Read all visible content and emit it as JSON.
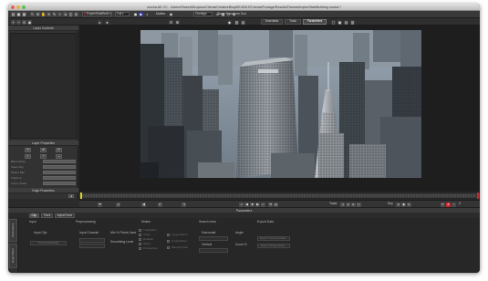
{
  "window": {
    "title": "mocha AE CC - /Users/Shared/Dropbox/Clients/CreativeBloq/EE40019/Tutorial/Footage/Results/Flames/empireStateBuilding.mocha *"
  },
  "toolbar": {
    "clip_name": "EmpireStateBuild",
    "resolution": "Full",
    "zoom_label": "Overlays",
    "show_transform": "Show Transform Tool",
    "views": [
      "Essentials",
      "Track",
      "Roto",
      "Parameters"
    ],
    "icons": [
      "new-icon",
      "open-icon",
      "save-icon",
      "pointer-icon",
      "zoom-icon",
      "hand-icon",
      "spline-x-icon",
      "bezier-x-icon",
      "add-point-icon",
      "transform-icon",
      "align-icon",
      "track-icon"
    ]
  },
  "left_panel": {
    "layer_controls_title": "Layer Controls",
    "layer_properties_title": "Layer Properties",
    "edge_properties_title": "Edge Properties",
    "fields": [
      "Blend Mode",
      "Insert Clip",
      "Motion Blur",
      "Track on",
      "Link to Track"
    ]
  },
  "transport": {
    "track_label": "Track",
    "key_label": "Key",
    "frame_value": "0"
  },
  "parameters": {
    "title": "Parameters",
    "tabs": [
      "Clip",
      "Track",
      "AdjustTrack"
    ],
    "side_tabs": [
      "Parameters",
      "Dope Sheet"
    ],
    "sections": {
      "input": "Input",
      "input_clip": "Input Clip",
      "preprocessing": "Preprocessing",
      "input_channel": "Input Channel",
      "min_pixels": "Min % Pixels Used",
      "smoothing": "Smoothing Level",
      "motion": "Motion",
      "translation": "Translation",
      "scale": "Scale",
      "rotation": "Rotation",
      "shear": "Shear",
      "perspective": "Perspective",
      "large_motion": "Large Motion",
      "small_motion": "Small Motion",
      "manual_track": "Manual Track",
      "search_area": "Search Area",
      "horizontal": "Horizontal",
      "vertical": "Vertical",
      "angle": "Angle",
      "zoom": "Zoom %",
      "export_data": "Export Data",
      "export_tracking": "Export Tracking Data...",
      "export_shape": "Export Shape Data...",
      "track_individual": "Track Individually",
      "auto": "Auto"
    }
  },
  "colors": {
    "accent_red": "#c8262d",
    "timeline_marker": "#d8d028",
    "panel_bg": "#2b2b2b"
  }
}
